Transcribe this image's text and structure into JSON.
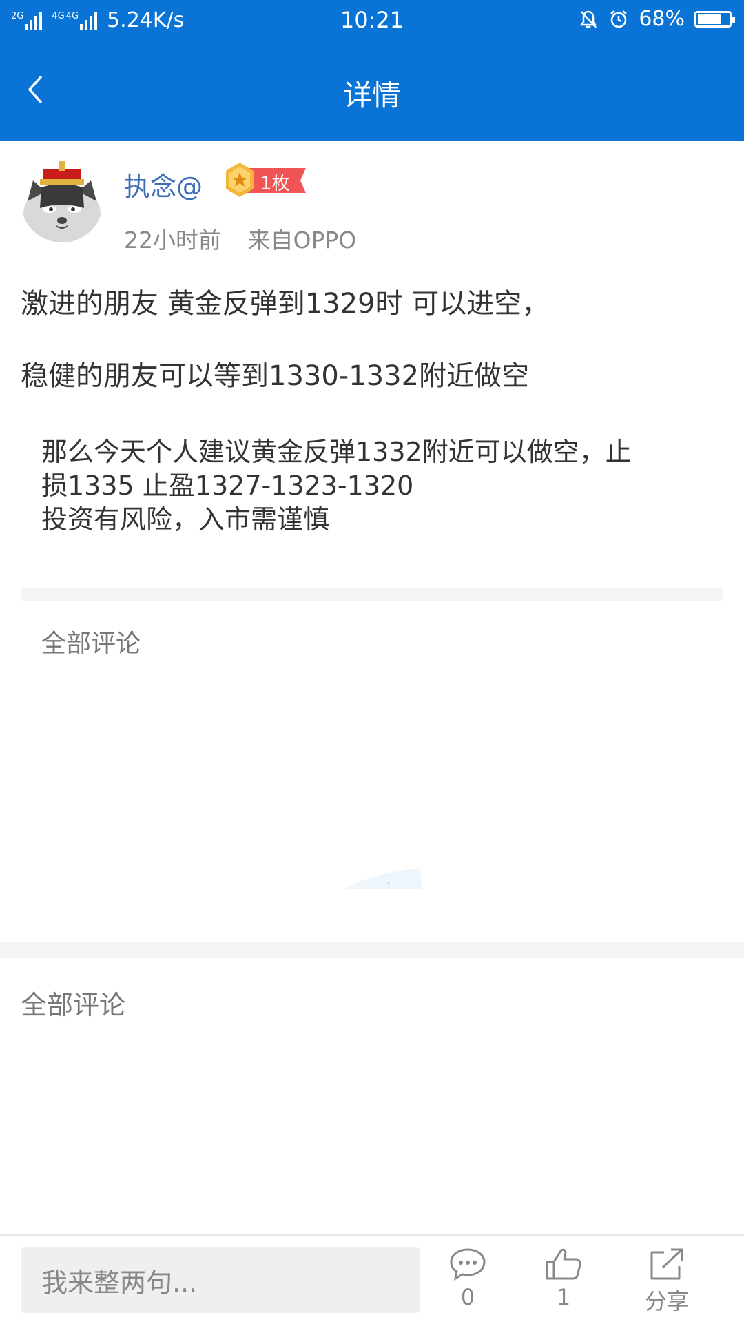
{
  "status_bar": {
    "net_tags": [
      "2G",
      "4G",
      "4G"
    ],
    "net_speed": "5.24K/s",
    "time": "10:21",
    "battery_percent_text": "68%",
    "battery_level": 0.68,
    "icons": [
      "signal-icon",
      "signal-icon",
      "mute-bell-icon",
      "alarm-icon",
      "battery-icon"
    ]
  },
  "nav": {
    "title": "详情",
    "back_icon": "chevron-left-icon"
  },
  "post": {
    "author": "执念@",
    "medal_label": "1枚",
    "time_ago": "22小时前",
    "source": "来自OPPO",
    "lines": [
      "激进的朋友 黄金反弹到1329时 可以进空，",
      "稳健的朋友可以等到1330-1332附近做空"
    ],
    "quote_lines": [
      "那么今天个人建议黄金反弹1332附近可以做空，止",
      "损1335  止盈1327-1323-1320",
      "投资有风险，入市需谨慎"
    ]
  },
  "comments_section": {
    "heading_top": "全部评论",
    "heading_bottom": "全部评论"
  },
  "bottom_bar": {
    "input_placeholder": "我来整两句...",
    "comment_count": "0",
    "like_count": "1",
    "share_label": "分享"
  },
  "colors": {
    "header_blue": "#0a74d6",
    "username_blue": "#3e6db5",
    "medal_red": "#f05454",
    "medal_gold": "#f3b53a"
  }
}
